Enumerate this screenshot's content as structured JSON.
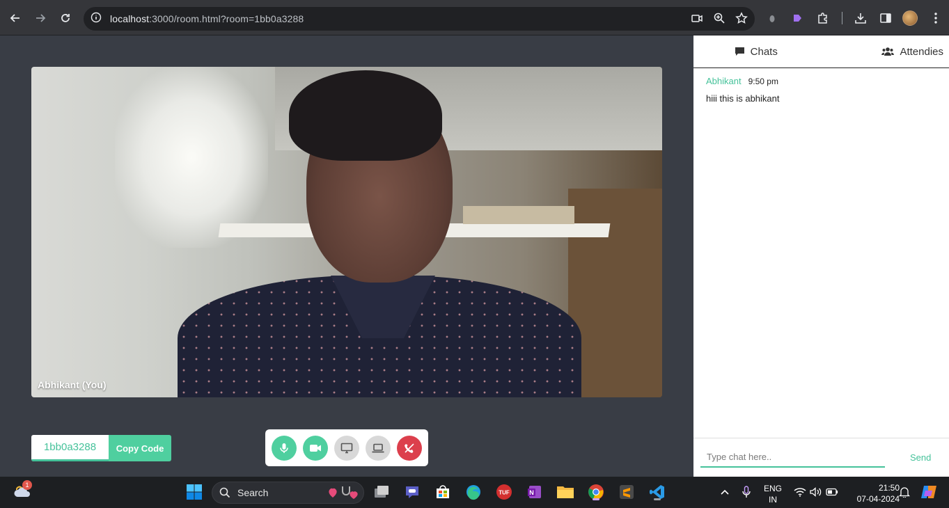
{
  "browser": {
    "url_host": "localhost",
    "url_rest": ":3000/room.html?room=1bb0a3288"
  },
  "video": {
    "participant_label": "Abhikant (You)"
  },
  "room": {
    "code": "1bb0a3288",
    "copy_label": "Copy Code"
  },
  "controls": {
    "colors": {
      "active": "#4fcf9f",
      "inactive": "#d8d8d8",
      "end": "#dc3f4c"
    },
    "items": [
      "microphone-icon",
      "video-camera-icon",
      "screen-share-icon",
      "laptop-icon",
      "end-call-icon"
    ]
  },
  "side_panel": {
    "tabs": [
      {
        "label": "Chats",
        "icon": "comment-icon"
      },
      {
        "label": "Attendies",
        "icon": "users-icon"
      }
    ],
    "messages": [
      {
        "sender": "Abhikant",
        "time": "9:50 pm",
        "text": "hiii this is abhikant"
      }
    ],
    "input_placeholder": "Type chat here..",
    "send_label": "Send"
  },
  "taskbar": {
    "weather_badge": "1",
    "search_label": "Search",
    "language": "ENG",
    "region": "IN",
    "time": "21:50",
    "date": "07-04-2024"
  }
}
